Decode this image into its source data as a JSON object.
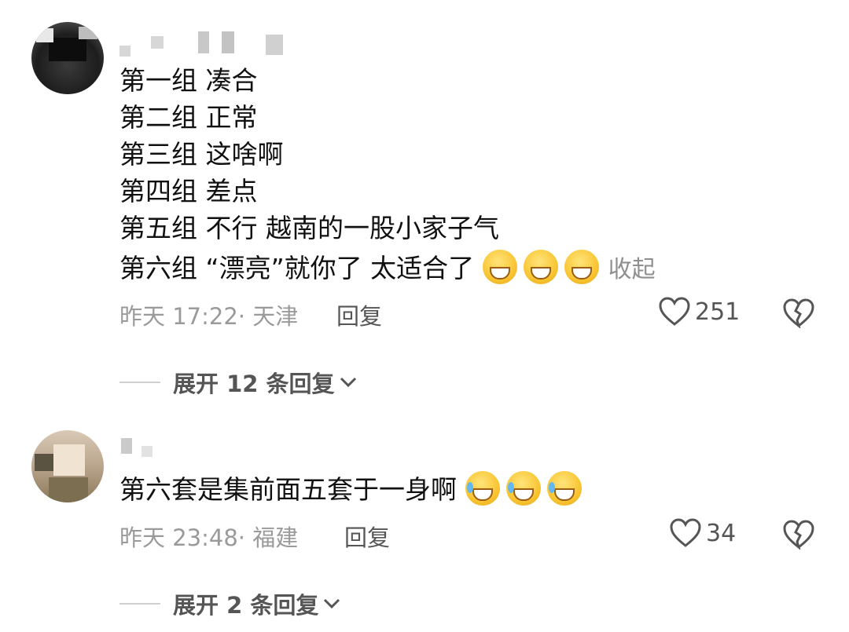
{
  "comments": [
    {
      "lines": [
        "第一组 凑合",
        "第二组 正常",
        "第三组 这啥啊",
        "第四组 差点",
        "第五组 不行 越南的一股小家子气",
        "第六组 “漂亮”就你了 太适合了"
      ],
      "emoji": [
        "grin-emoji",
        "grin-emoji",
        "grin-emoji"
      ],
      "collapse_label": "收起",
      "meta": "昨天 17:22· 天津",
      "reply_label": "回复",
      "likes": "251",
      "expand_label": "展开 12 条回复"
    },
    {
      "lines": [
        "第六套是集前面五套于一身啊"
      ],
      "emoji": [
        "laugh-cry-emoji",
        "laugh-cry-emoji",
        "laugh-cry-emoji"
      ],
      "meta": "昨天 23:48· 福建",
      "reply_label": "回复",
      "likes": "34",
      "expand_label": "展开 2 条回复"
    }
  ],
  "colors": {
    "meta": "#9a9a9a",
    "action": "#555555",
    "text": "#111111"
  }
}
